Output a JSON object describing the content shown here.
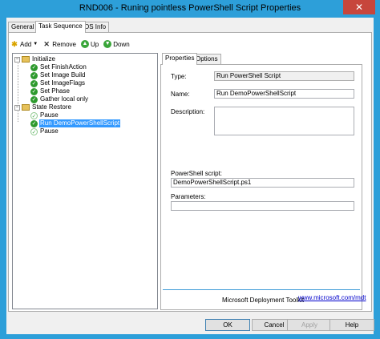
{
  "window": {
    "title": "RND006 - Runing pointless PowerShell Script Properties",
    "close_glyph": "✕"
  },
  "tabs": [
    "General",
    "Task Sequence",
    "OS Info"
  ],
  "toolbar": {
    "add_label": "Add",
    "remove_label": "Remove",
    "up_label": "Up",
    "down_label": "Down"
  },
  "tree": {
    "items": [
      {
        "label": "Initialize",
        "type": "group",
        "expanded": true
      },
      {
        "label": "Set FinishAction",
        "type": "step"
      },
      {
        "label": "Set Image Build",
        "type": "step"
      },
      {
        "label": "Set ImageFlags",
        "type": "step"
      },
      {
        "label": "Set Phase",
        "type": "step"
      },
      {
        "label": "Gather local only",
        "type": "step"
      },
      {
        "label": "State Restore",
        "type": "group",
        "expanded": true
      },
      {
        "label": "Pause",
        "type": "step-disabled"
      },
      {
        "label": "Run DemoPowerShellScript",
        "type": "step",
        "selected": true
      },
      {
        "label": "Pause",
        "type": "step-disabled"
      }
    ]
  },
  "properties": {
    "tabs": [
      "Properties",
      "Options"
    ],
    "type_label": "Type:",
    "type_value": "Run PowerShell Script",
    "name_label": "Name:",
    "name_value": "Run DemoPowerShellScript",
    "description_label": "Description:",
    "description_value": "",
    "script_label": "PowerShell script:",
    "script_value": "DemoPowerShellScript.ps1",
    "parameters_label": "Parameters:",
    "parameters_value": "",
    "footer_text": "Microsoft Deployment Toolkit",
    "footer_link": "www.microsoft.com/mdt"
  },
  "buttons": {
    "ok": "OK",
    "cancel": "Cancel",
    "apply": "Apply",
    "help": "Help"
  },
  "colors": {
    "title_bar": "#2d9fd9",
    "close_button": "#c7463c",
    "selection": "#3399ff",
    "separator": "#3f9bd8"
  }
}
